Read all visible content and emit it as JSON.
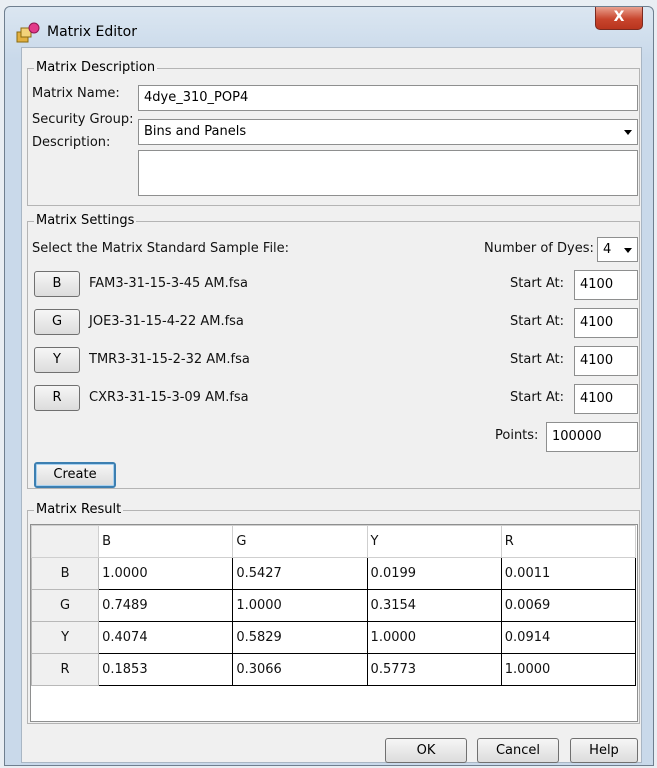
{
  "window": {
    "title": "Matrix Editor",
    "close_label": "X"
  },
  "description_group": {
    "legend": "Matrix Description",
    "name_label": "Matrix Name:",
    "name_value": "4dye_310_POP4",
    "security_label": "Security Group:",
    "security_value": "Bins and Panels",
    "description_label": "Description:",
    "description_value": ""
  },
  "settings_group": {
    "legend": "Matrix Settings",
    "select_label": "Select the Matrix Standard Sample File:",
    "dyes_label": "Number of Dyes:",
    "dyes_value": "4",
    "start_label": "Start At:",
    "dyes": [
      {
        "button": "B",
        "file": "FAM3-31-15-3-45 AM.fsa",
        "start": "4100"
      },
      {
        "button": "G",
        "file": "JOE3-31-15-4-22 AM.fsa",
        "start": "4100"
      },
      {
        "button": "Y",
        "file": "TMR3-31-15-2-32 AM.fsa",
        "start": "4100"
      },
      {
        "button": "R",
        "file": "CXR3-31-15-3-09 AM.fsa",
        "start": "4100"
      }
    ],
    "points_label": "Points:",
    "points_value": "100000",
    "create_label": "Create"
  },
  "result_group": {
    "legend": "Matrix Result",
    "columns": [
      "B",
      "G",
      "Y",
      "R"
    ],
    "rows": [
      {
        "label": "B",
        "values": [
          "1.0000",
          "0.5427",
          "0.0199",
          "0.0011"
        ]
      },
      {
        "label": "G",
        "values": [
          "0.7489",
          "1.0000",
          "0.3154",
          "0.0069"
        ]
      },
      {
        "label": "Y",
        "values": [
          "0.4074",
          "0.5829",
          "1.0000",
          "0.0914"
        ]
      },
      {
        "label": "R",
        "values": [
          "0.1853",
          "0.3066",
          "0.5773",
          "1.0000"
        ]
      }
    ]
  },
  "footer": {
    "ok_label": "OK",
    "cancel_label": "Cancel",
    "help_label": "Help"
  },
  "colors": {
    "close_button": "#c8452d",
    "default_button_border": "#3c7fb1"
  }
}
